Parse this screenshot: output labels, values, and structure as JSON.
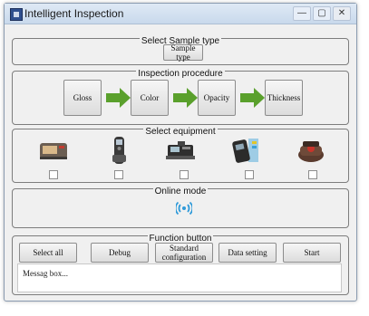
{
  "window": {
    "title": "Intelligent Inspection",
    "controls": [
      "—",
      "▢",
      "✕"
    ]
  },
  "sample_type": {
    "group_label": "Select Sample type",
    "button_label": "Sample type"
  },
  "procedure": {
    "group_label": "Inspection procedure",
    "steps": [
      "Gloss",
      "Color",
      "Opacity",
      "Thickness"
    ],
    "arrow_color": "#5aa02c"
  },
  "equipment": {
    "group_label": "Select equipment",
    "items": [
      {
        "icon": "gloss-meter-icon",
        "checked": false
      },
      {
        "icon": "color-meter-icon",
        "checked": false
      },
      {
        "icon": "opacity-meter-icon",
        "checked": false
      },
      {
        "icon": "thickness-gauge-icon",
        "checked": false
      },
      {
        "icon": "haze-meter-icon",
        "checked": false
      }
    ]
  },
  "online_mode": {
    "group_label": "Online mode",
    "icon": "wireless-signal-icon",
    "icon_color": "#2f9ad9"
  },
  "function": {
    "group_label": "Function button",
    "buttons": [
      "Select all",
      "Debug",
      "Standard configuration",
      "Data setting",
      "Start"
    ]
  },
  "message_box": {
    "text": "Messag box..."
  }
}
